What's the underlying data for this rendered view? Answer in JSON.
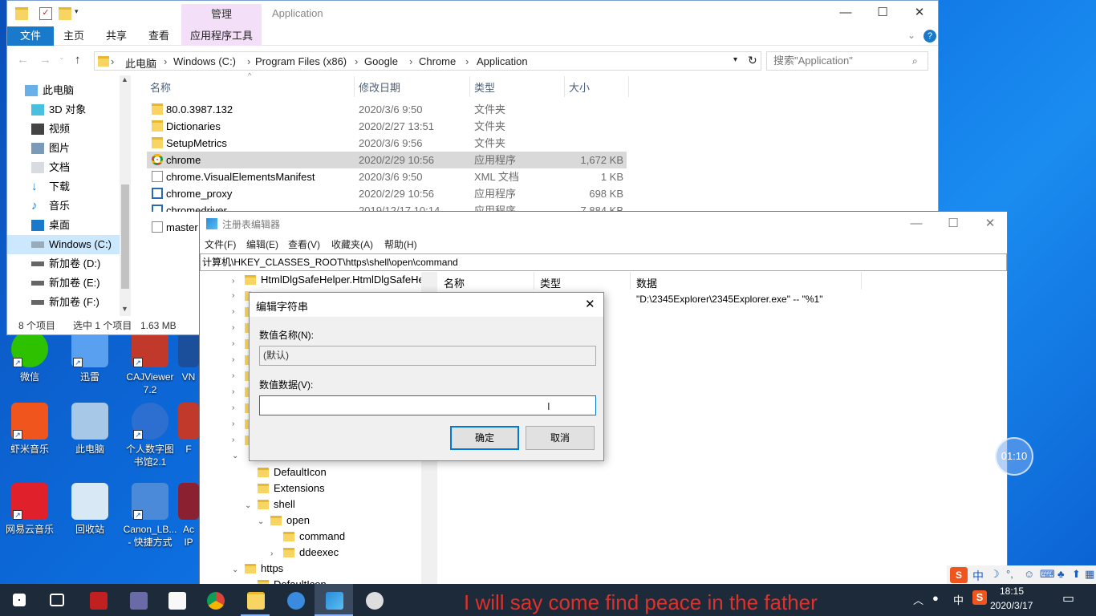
{
  "explorer": {
    "manage_tab": "管理",
    "window_title": "Application",
    "ribbon_tabs": [
      "文件",
      "主页",
      "共享",
      "查看",
      "应用程序工具"
    ],
    "breadcrumb": [
      "此电脑",
      "Windows (C:)",
      "Program Files (x86)",
      "Google",
      "Chrome",
      "Application"
    ],
    "search_placeholder": "搜索\"Application\"",
    "nav": [
      "此电脑",
      "3D 对象",
      "视频",
      "图片",
      "文档",
      "下载",
      "音乐",
      "桌面",
      "Windows (C:)",
      "新加卷 (D:)",
      "新加卷 (E:)",
      "新加卷 (F:)"
    ],
    "columns": {
      "name": "名称",
      "date": "修改日期",
      "type": "类型",
      "size": "大小"
    },
    "files": [
      {
        "name": "80.0.3987.132",
        "date": "2020/3/6 9:50",
        "type": "文件夹",
        "size": ""
      },
      {
        "name": "Dictionaries",
        "date": "2020/2/27 13:51",
        "type": "文件夹",
        "size": ""
      },
      {
        "name": "SetupMetrics",
        "date": "2020/3/6 9:56",
        "type": "文件夹",
        "size": ""
      },
      {
        "name": "chrome",
        "date": "2020/2/29 10:56",
        "type": "应用程序",
        "size": "1,672 KB"
      },
      {
        "name": "chrome.VisualElementsManifest",
        "date": "2020/3/6 9:50",
        "type": "XML 文档",
        "size": "1 KB"
      },
      {
        "name": "chrome_proxy",
        "date": "2020/2/29 10:56",
        "type": "应用程序",
        "size": "698 KB"
      },
      {
        "name": "chromedriver",
        "date": "2019/12/17 10:14",
        "type": "应用程序",
        "size": "7,884 KB"
      },
      {
        "name": "master",
        "date": "",
        "type": "",
        "size": ""
      }
    ],
    "status": {
      "count": "8 个项目",
      "selected": "选中 1 个项目",
      "size": "1.63 MB"
    }
  },
  "regedit": {
    "title": "注册表编辑器",
    "menu": [
      "文件(F)",
      "编辑(E)",
      "查看(V)",
      "收藏夹(A)",
      "帮助(H)"
    ],
    "path": "计算机\\HKEY_CLASSES_ROOT\\https\\shell\\open\\command",
    "tree": [
      "HtmlDlgSafeHelper.HtmlDlgSafeHe",
      "DefaultIcon",
      "Extensions",
      "shell",
      "open",
      "command",
      "ddeexec",
      "https",
      "DefaultIcon"
    ],
    "columns": {
      "name": "名称",
      "type": "类型",
      "data": "数据"
    },
    "value_data": "\"D:\\2345Explorer\\2345Explorer.exe\" -- \"%1\""
  },
  "dialog": {
    "title": "编辑字符串",
    "name_label": "数值名称(N):",
    "name_value": "(默认)",
    "data_label": "数值数据(V):",
    "data_value": "",
    "ok": "确定",
    "cancel": "取消"
  },
  "desktop": {
    "icons": [
      "微信",
      "迅雷",
      "CAJViewer 7.2",
      "VN",
      "虾米音乐",
      "此电脑",
      "个人数字图书馆2.1",
      "F",
      "网易云音乐",
      "回收站",
      "Canon_LB... - 快捷方式",
      "Ac IP"
    ]
  },
  "timer": "01:10",
  "caption": "I will say come find peace in the father",
  "tray": {
    "time": "18:15",
    "date": "2020/3/17",
    "ime": "中"
  },
  "colors": {
    "accent": "#1979ca",
    "selection": "#cce8ff",
    "caption": "#e0302a"
  }
}
